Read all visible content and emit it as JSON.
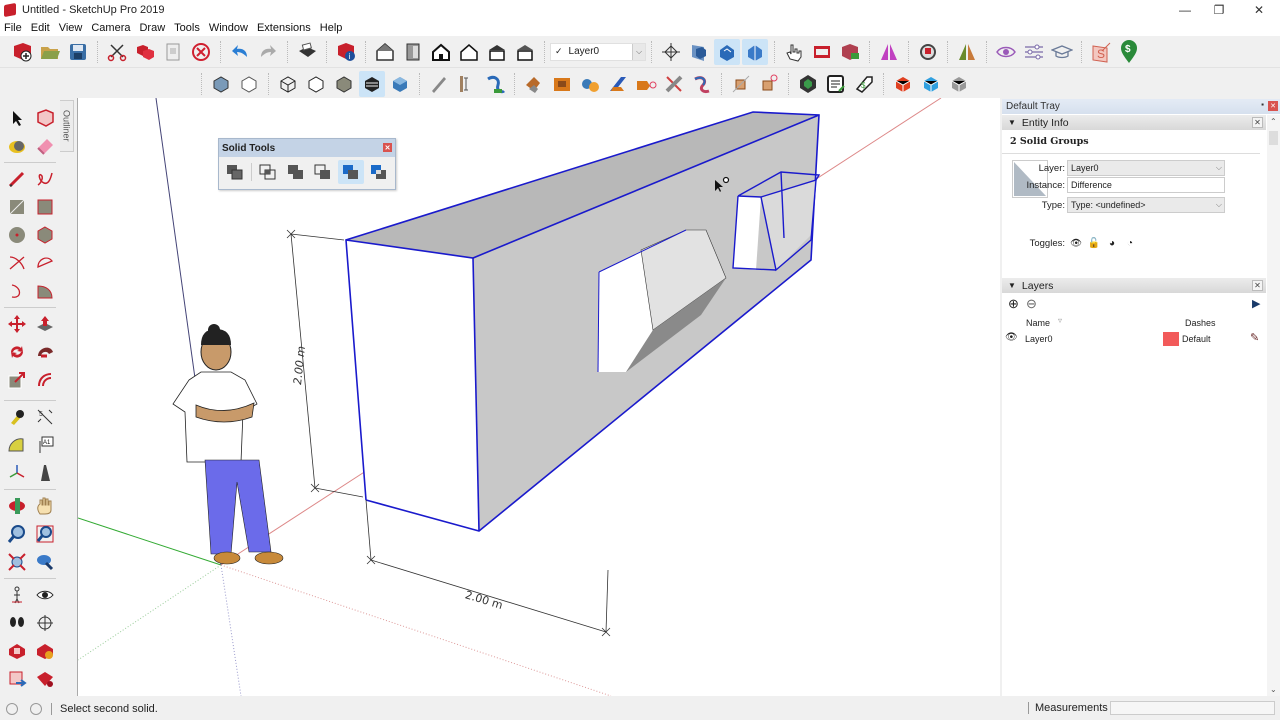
{
  "window": {
    "title": "Untitled - SketchUp Pro 2019",
    "controls": [
      "minimize",
      "restore",
      "close"
    ]
  },
  "menu": [
    "File",
    "Edit",
    "View",
    "Camera",
    "Draw",
    "Tools",
    "Window",
    "Extensions",
    "Help"
  ],
  "toolbar_top": {
    "groups": [
      [
        "new-model",
        "open",
        "save"
      ],
      [
        "cut",
        "copy",
        "paste",
        "erase"
      ],
      [
        "undo",
        "redo"
      ],
      [
        "print"
      ],
      [
        "model-info"
      ],
      [
        "iso-view",
        "front-view",
        "top-view",
        "right-view",
        "back-view",
        "left-view"
      ],
      [
        "layer-selector"
      ],
      [
        "section-plane",
        "display-section-planes",
        "display-section-cuts",
        "display-section-fill"
      ],
      [
        "interact",
        "dynamic-components",
        "component-attributes"
      ],
      [
        "mirror"
      ],
      [
        "ruby-console"
      ],
      [
        "flip-along"
      ],
      [
        "view-hidden",
        "sliders",
        "instructor"
      ],
      [
        "sandbox",
        "price-tag"
      ]
    ],
    "layer_select": {
      "checked": "✓",
      "value": "Layer0"
    }
  },
  "toolbar_second": {
    "groups": [
      [
        "xray",
        "back-edges"
      ],
      [
        "wireframe",
        "hidden-line",
        "shaded",
        "shaded-with-textures",
        "monochrome"
      ],
      [
        "sandbox-smoove",
        "stamp",
        "drape"
      ],
      [
        "push-pull-tool",
        "follow-me-tool",
        "offset-tool",
        "intersect-faces",
        "add-detail",
        "flip-edge",
        "smoove"
      ],
      [
        "section-plane-add",
        "section-plane-remove"
      ],
      [
        "warehouse",
        "generate-report",
        "classifier"
      ],
      [
        "extension-warehouse-red",
        "extension-warehouse-blue",
        "extension-manager"
      ]
    ]
  },
  "left_toolbar": {
    "rows": [
      [
        "select",
        "make-component"
      ],
      [
        "paint-bucket",
        "eraser"
      ],
      [
        "line",
        "freehand"
      ],
      [
        "rectangle",
        "rotated-rectangle"
      ],
      [
        "circle",
        "polygon"
      ],
      [
        "arc",
        "two-point-arc"
      ],
      [
        "three-point-arc",
        "pie"
      ],
      [
        "move",
        "push-pull"
      ],
      [
        "rotate",
        "follow-me"
      ],
      [
        "scale",
        "offset"
      ],
      [
        "tape-measure",
        "dimension"
      ],
      [
        "protractor",
        "text"
      ],
      [
        "axes",
        "3d-text"
      ],
      [
        "orbit",
        "pan"
      ],
      [
        "zoom",
        "zoom-window"
      ],
      [
        "zoom-extents",
        "previous-view"
      ],
      [
        "position-camera",
        "look-around"
      ],
      [
        "walk",
        "section-plane"
      ],
      [
        "warehouse-3d",
        "share-model"
      ],
      [
        "share-component",
        "extension-warehouse"
      ]
    ]
  },
  "outliner_tab": "Outliner",
  "solid_tools": {
    "title": "Solid Tools",
    "tools": [
      "outer-shell",
      "intersect",
      "union",
      "subtract",
      "trim",
      "split"
    ],
    "active_tool": "trim"
  },
  "viewport": {
    "dimension_vertical": "2.00 m",
    "dimension_horizontal": "2.00 m",
    "cursor_hint": "select-second-solid"
  },
  "tray": {
    "title": "Default Tray",
    "entity_info": {
      "header": "Entity Info",
      "selection": "2 Solid Groups",
      "layer_label": "Layer:",
      "layer_value": "Layer0",
      "instance_label": "Instance:",
      "instance_value": "Difference",
      "type_label": "Type:",
      "type_value": "Type: <undefined>",
      "toggles_label": "Toggles:",
      "toggles": [
        "hidden",
        "locked",
        "receive-shadows",
        "cast-shadows"
      ]
    },
    "layers": {
      "header": "Layers",
      "columns": [
        "Name",
        "Dashes"
      ],
      "rows": [
        {
          "visible": true,
          "name": "Layer0",
          "color": "#f25a5a",
          "dashes": "Default"
        }
      ]
    }
  },
  "status": {
    "message": "Select second solid.",
    "measurements_label": "Measurements",
    "measurements_value": ""
  },
  "colors": {
    "selection_edge": "#1a1acc",
    "face_gray": "#c4c4c4",
    "layer_color": "#f25a5a"
  }
}
